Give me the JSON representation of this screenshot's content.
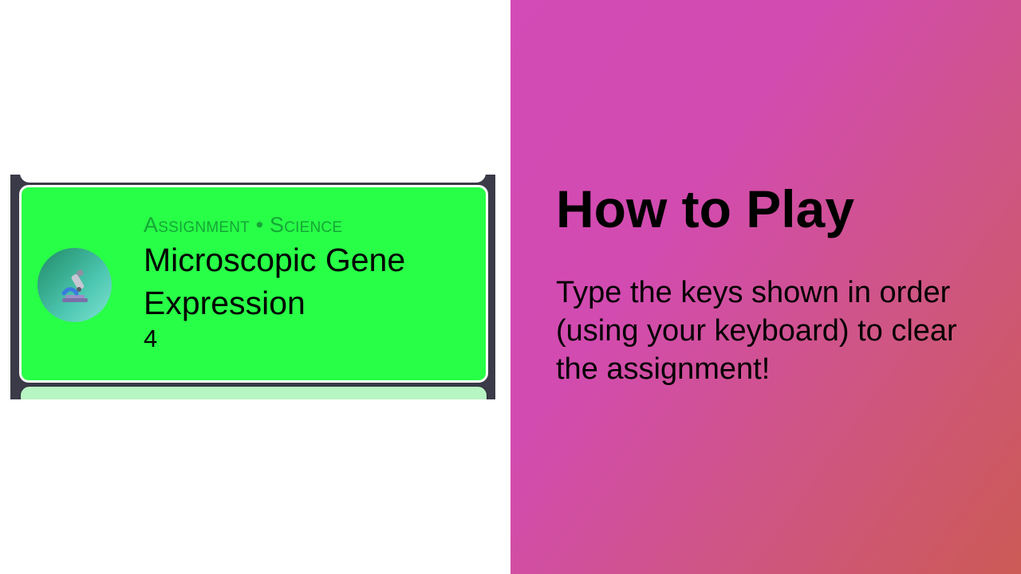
{
  "assignment_card": {
    "meta": "Assignment • Science",
    "title": "Microscopic Gene Expression",
    "count": "4",
    "icon": "microscope-icon"
  },
  "help": {
    "title": "How to Play",
    "body": "Type the keys shown in order (using your keyboard) to clear the assignment!"
  },
  "colors": {
    "active_card": "#28ff47",
    "next_card": "#b7f5c2",
    "card_strip": "#3a3a48",
    "gradient_start": "#d24bb6",
    "gradient_end": "#cc5a55"
  }
}
